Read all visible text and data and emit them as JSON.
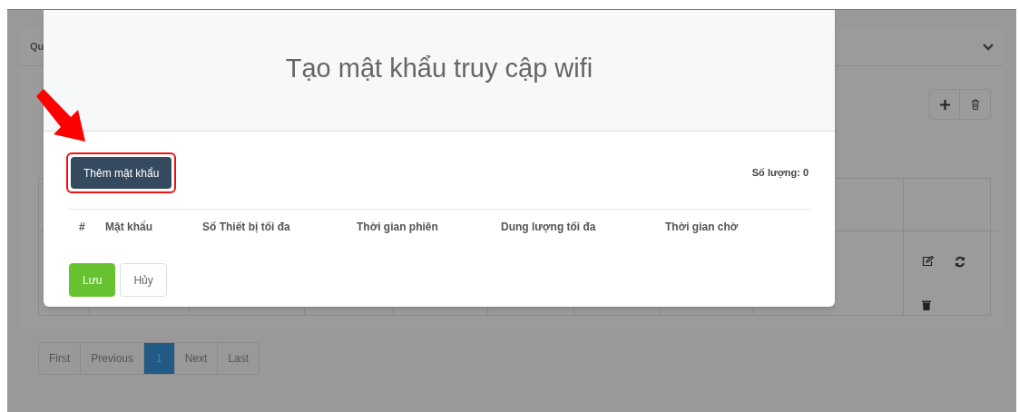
{
  "background": {
    "panel_title": "Qu",
    "pagination": [
      {
        "label": "First",
        "selected": false
      },
      {
        "label": "Previous",
        "selected": false
      },
      {
        "label": "1",
        "selected": true
      },
      {
        "label": "Next",
        "selected": false
      },
      {
        "label": "Last",
        "selected": false
      }
    ]
  },
  "modal": {
    "title": "Tạo mật khẩu truy cập wifi",
    "add_button": "Thêm mật khẩu",
    "count": "Số lượng: 0",
    "columns": [
      "#",
      "Mật khẩu",
      "Số Thiết bị tối đa",
      "Thời gian phiên",
      "Dung lượng tối đa",
      "Thời gian chờ"
    ],
    "buttons": [
      {
        "label": "Lưu",
        "kind": "primary"
      },
      {
        "label": "Hủy",
        "kind": "default"
      }
    ]
  }
}
